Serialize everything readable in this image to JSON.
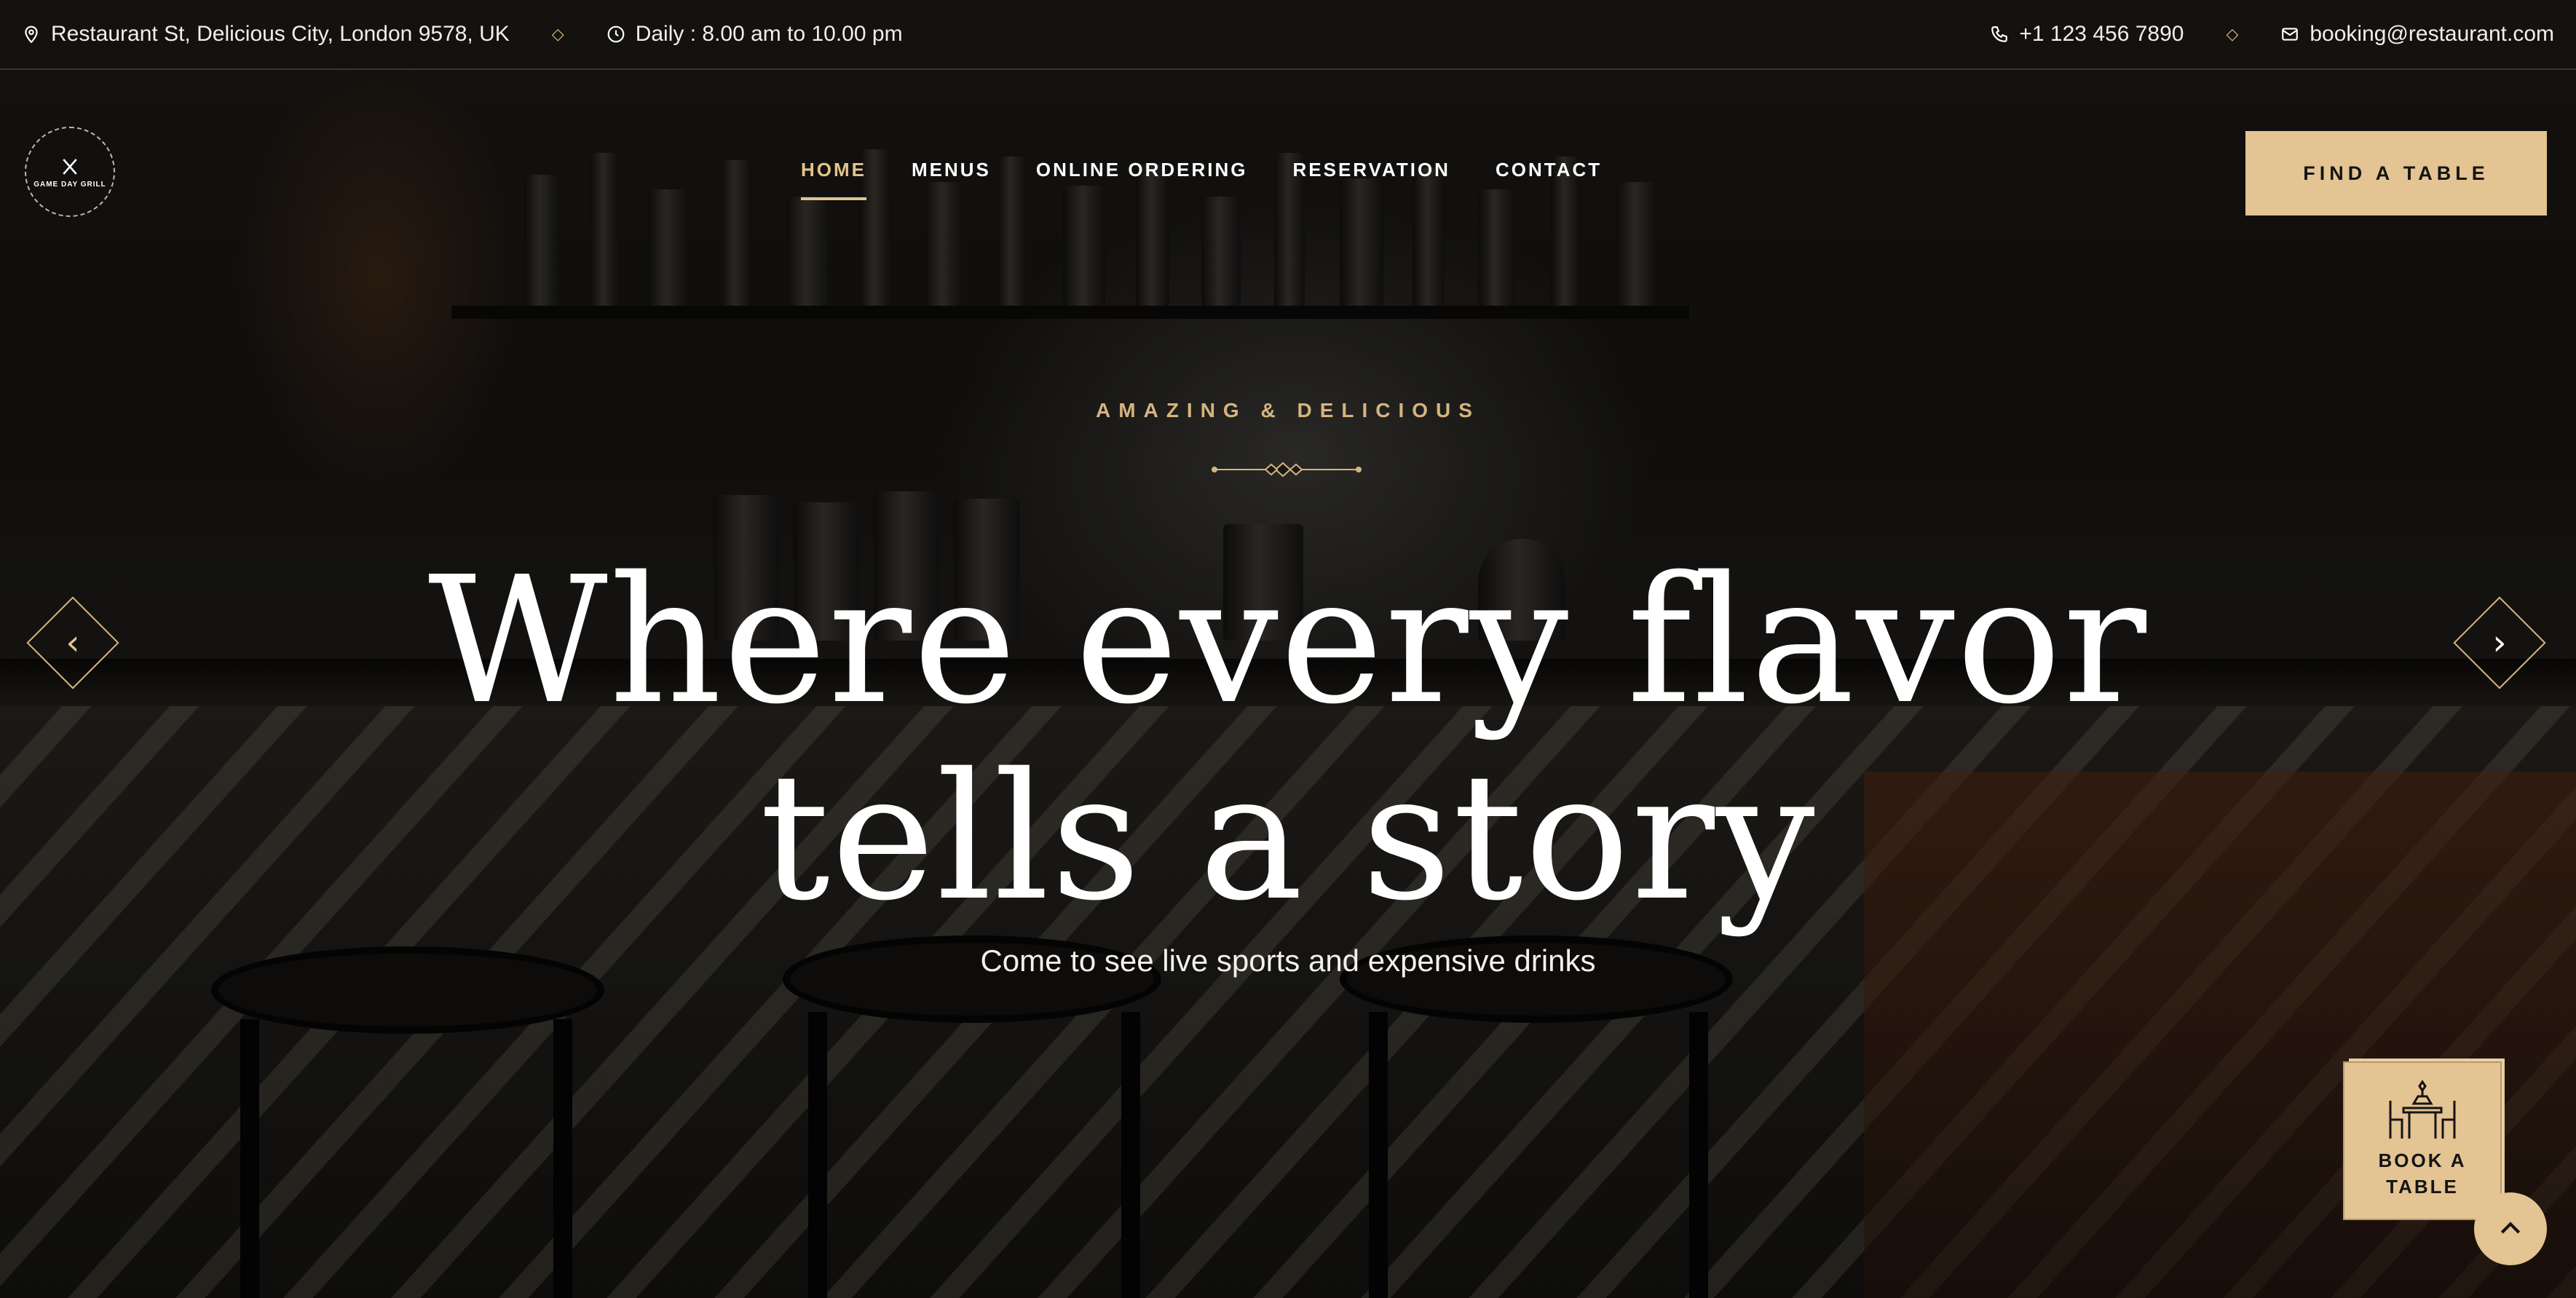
{
  "topbar": {
    "address": "Restaurant St, Delicious City, London 9578, UK",
    "hours": "Daily : 8.00 am to 10.00 pm",
    "phone": "+1 123 456 7890",
    "email": "booking@restaurant.com"
  },
  "logo": {
    "text": "GAME DAY GRILL"
  },
  "nav": {
    "items": [
      {
        "label": "HOME"
      },
      {
        "label": "MENUS"
      },
      {
        "label": "ONLINE ORDERING"
      },
      {
        "label": "RESERVATION"
      },
      {
        "label": "CONTACT"
      }
    ],
    "active": "HOME"
  },
  "header": {
    "cta_label": "FIND A TABLE"
  },
  "hero": {
    "tagline": "AMAZING & DELICIOUS",
    "headline_line1": "Where every flavor",
    "headline_line2": "tells a story",
    "subline": "Come to see live sports and expensive drinks"
  },
  "widget": {
    "label_line1": "BOOK A",
    "label_line2": "TABLE"
  },
  "colors": {
    "accent": "#e3c492",
    "accent_text": "#d5b57e",
    "background": "#0d0b09"
  },
  "icons": [
    "map-pin-icon",
    "clock-icon",
    "phone-icon",
    "mail-icon",
    "diamond-separator-icon",
    "chevron-left-icon",
    "chevron-right-icon",
    "dining-table-icon",
    "arrow-up-icon"
  ]
}
